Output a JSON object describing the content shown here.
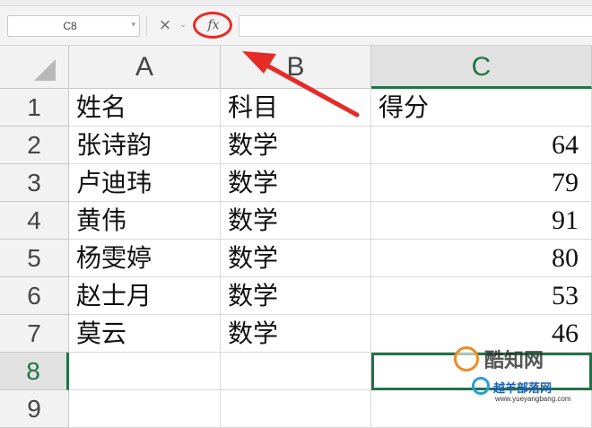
{
  "formula_bar": {
    "name_box": "C8",
    "cancel_glyph": "×",
    "chevron_glyph": "⌄",
    "fx_label": "fx",
    "formula_value": ""
  },
  "columns": [
    {
      "label": "A",
      "selected": false
    },
    {
      "label": "B",
      "selected": false
    },
    {
      "label": "C",
      "selected": true
    }
  ],
  "rows": [
    {
      "label": "1",
      "cells": [
        "姓名",
        "科目",
        "得分"
      ]
    },
    {
      "label": "2",
      "cells": [
        "张诗韵",
        "数学",
        "64"
      ]
    },
    {
      "label": "3",
      "cells": [
        "卢迪玮",
        "数学",
        "79"
      ]
    },
    {
      "label": "4",
      "cells": [
        "黄伟",
        "数学",
        "91"
      ]
    },
    {
      "label": "5",
      "cells": [
        "杨雯婷",
        "数学",
        "80"
      ]
    },
    {
      "label": "6",
      "cells": [
        "赵士月",
        "数学",
        "53"
      ]
    },
    {
      "label": "7",
      "cells": [
        "莫云",
        "数学",
        "46"
      ]
    },
    {
      "label": "8",
      "cells": [
        "",
        "",
        ""
      ]
    },
    {
      "label": "9",
      "cells": [
        "",
        "",
        ""
      ]
    }
  ],
  "active_cell": "C8",
  "annotation": {
    "color": "#e62b26"
  },
  "watermark": {
    "line1": "酷知网",
    "line2": "越羊部落网",
    "line3": "www.yueyangbang.com"
  },
  "colors": {
    "accent": "#217346",
    "annotation": "#e62b26"
  }
}
